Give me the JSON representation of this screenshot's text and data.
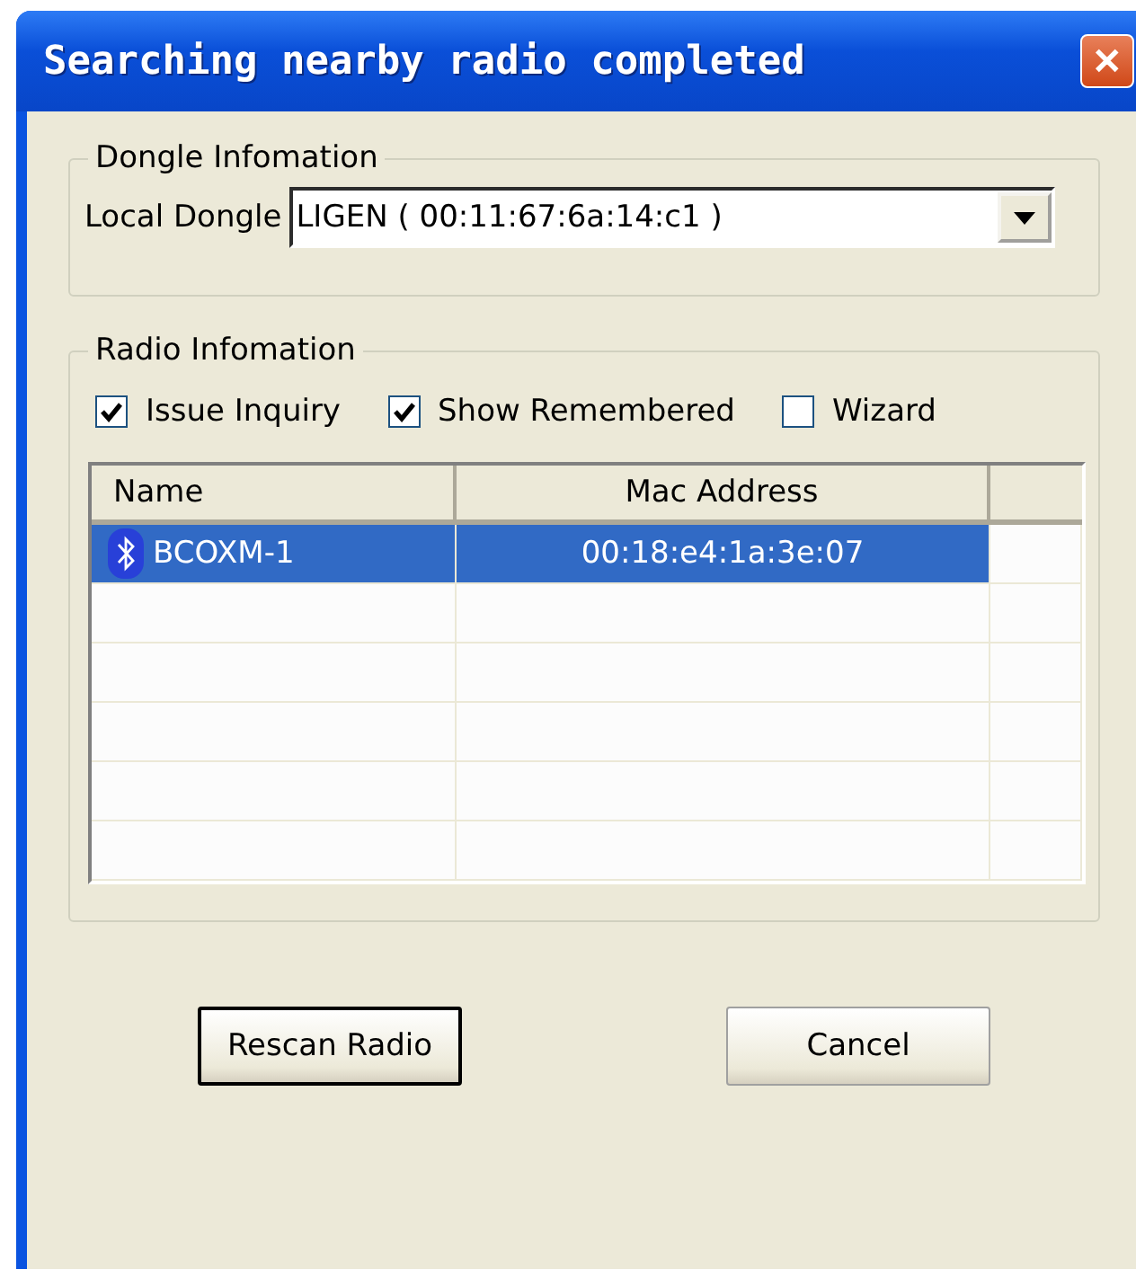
{
  "window": {
    "title": "Searching nearby radio completed",
    "close": "✕"
  },
  "dongle_group": {
    "title": "Dongle Infomation",
    "label": "Local Dongle",
    "value": "LIGEN ( 00:11:67:6a:14:c1 )"
  },
  "radio_group": {
    "title": "Radio Infomation",
    "options": [
      {
        "label": "Issue Inquiry",
        "checked": true
      },
      {
        "label": "Show Remembered",
        "checked": true
      },
      {
        "label": "Wizard",
        "checked": false
      }
    ],
    "table": {
      "columns": [
        "Name",
        "Mac Address"
      ],
      "rows": [
        {
          "name": "BCOXM-1",
          "mac": "00:18:e4:1a:3e:07",
          "selected": true
        }
      ]
    }
  },
  "buttons": [
    {
      "label": "Rescan Radio",
      "default": true
    },
    {
      "label": "Cancel",
      "default": false
    }
  ]
}
